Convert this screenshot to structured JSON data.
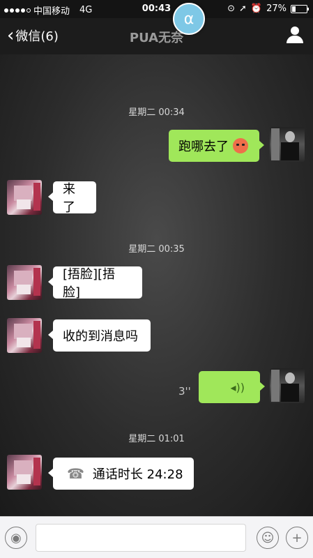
{
  "status_bar": {
    "carrier": "中国移动",
    "network": "4G",
    "time": "00:43",
    "battery": "27%",
    "battery_level": 0.27,
    "icons": [
      "lock-rotation-icon",
      "location-arrow-icon",
      "alarm-icon"
    ]
  },
  "overlay": {
    "symbol": "α"
  },
  "nav": {
    "back_label": "微信(6)",
    "title": "PUA无奈"
  },
  "messages": {
    "ts1": "星期二 00:34",
    "m1": "跑哪去了",
    "m2": "来了",
    "ts2": "星期二 00:35",
    "m3": "[捂脸][捂脸]",
    "m4": "收的到消息吗",
    "voice_duration": "3''",
    "ts3": "星期二 01:01",
    "m6": "通话时长 24:28"
  },
  "input": {
    "placeholder": ""
  },
  "colors": {
    "outgoing_bubble": "#a0e75a",
    "incoming_bubble": "#ffffff",
    "accent_badge": "#7ec8e6"
  }
}
